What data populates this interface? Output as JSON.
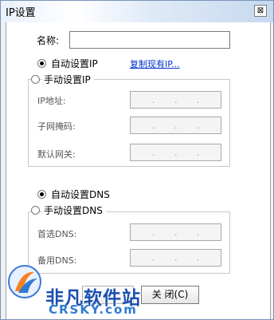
{
  "window": {
    "title": "IP设置",
    "close_glyph": "⊠"
  },
  "name_field": {
    "label": "名称:",
    "value": ""
  },
  "ip_section": {
    "auto_label": "自动设置IP",
    "auto_selected": true,
    "copy_link": "复制现有IP...",
    "manual_label": "手动设置IP",
    "manual_selected": false,
    "fields": [
      {
        "label": "IP地址:"
      },
      {
        "label": "子网掩码:"
      },
      {
        "label": "默认网关:"
      }
    ]
  },
  "dns_section": {
    "auto_label": "自动设置DNS",
    "auto_selected": true,
    "manual_label": "手动设置DNS",
    "manual_selected": false,
    "fields": [
      {
        "label": "首选DNS:"
      },
      {
        "label": "备用DNS:"
      }
    ]
  },
  "buttons": {
    "close_label": "关 闭(C)"
  },
  "watermark": {
    "brand": "非凡软件站",
    "domain": "CRSKY.com"
  },
  "ip_dot": "."
}
